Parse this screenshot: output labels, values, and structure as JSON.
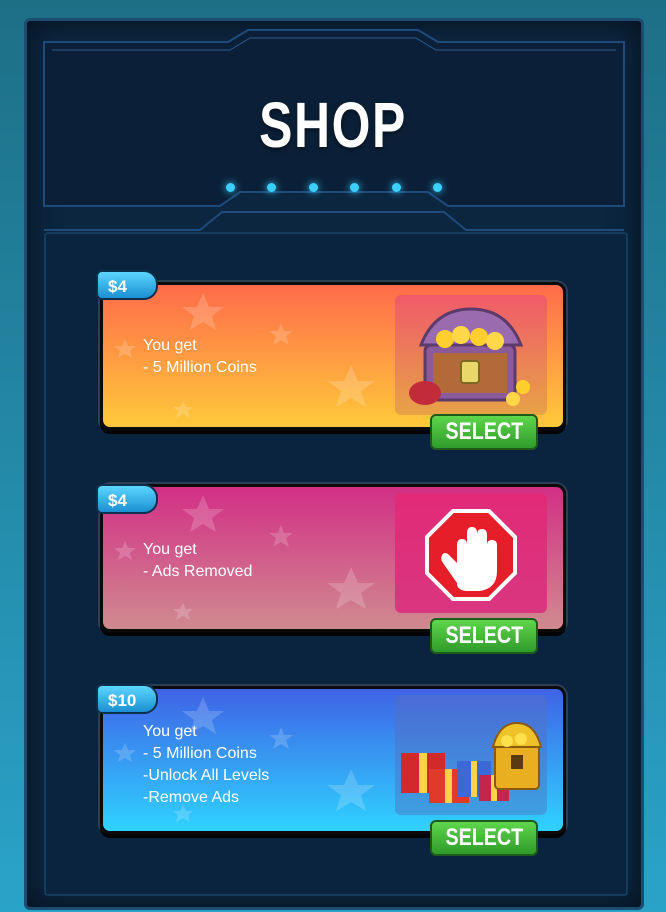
{
  "title": "SHOP",
  "packs": [
    {
      "price": "$4",
      "text": "You get\n- 5 Million Coins",
      "button": "SELECT",
      "icon": "treasure-chest-icon"
    },
    {
      "price": "$4",
      "text": "You get\n- Ads Removed",
      "button": "SELECT",
      "icon": "stop-hand-icon"
    },
    {
      "price": "$10",
      "text": "You get\n- 5 Million Coins\n-Unlock All Levels\n-Remove Ads",
      "button": "SELECT",
      "icon": "gifts-and-chest-icon"
    }
  ],
  "colors": {
    "card1": [
      "#ff6b4a",
      "#ffc93a"
    ],
    "card2": [
      "#d22f86",
      "#d08a8f"
    ],
    "card3": [
      "#3f63e6",
      "#2fd2ff"
    ],
    "select": "#3fb73a",
    "price": "#2ab3e8"
  }
}
